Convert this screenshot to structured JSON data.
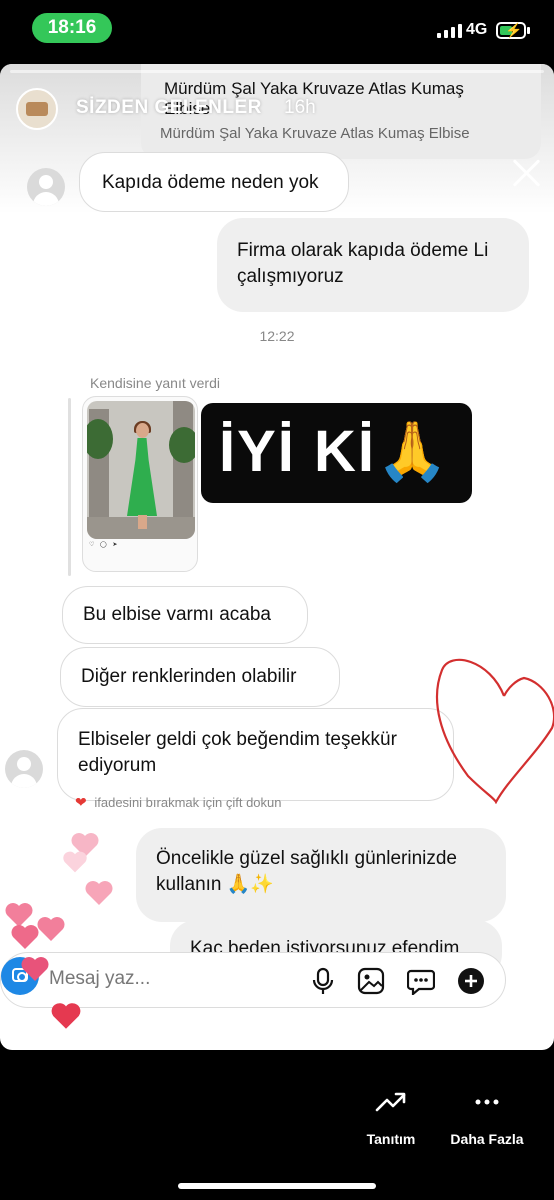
{
  "status_bar": {
    "time": "18:16",
    "network": "4G",
    "battery_level": 0.55
  },
  "story": {
    "title": "SİZDEN GELENLER",
    "time_ago": "16h",
    "product_preview": {
      "title": "Mürdüm Şal Yaka Kruvaze Atlas Kumaş Elbise",
      "subtitle": "Mürdüm Şal Yaka Kruvaze Atlas Kumaş Elbise"
    },
    "chat": {
      "messages": [
        {
          "text": "Kapıda ödeme neden yok"
        },
        {
          "text": "Firma olarak kapıda ödeme Li çalışmıyoruz"
        },
        {
          "text": "Bu elbise  varmı acaba"
        },
        {
          "text": "Diğer  renklerinden olabilir"
        },
        {
          "text": "Elbiseler geldi çok beğendim  teşekkür ediyorum"
        },
        {
          "text": "Öncelikle güzel sağlıklı günlerinizde kullanın 🙏✨"
        },
        {
          "text": "Kaç beden istiyorsunuz efendim"
        }
      ],
      "timestamp": "12:22",
      "reply_label": "Kendisine yanıt verdi",
      "reply_sticker": "İYİ Kİ🙏",
      "reaction_hint": "ifadesini bırakmak için çift dokun",
      "reaction_heart": "❤",
      "input_placeholder": "Mesaj yaz..."
    }
  },
  "bottom_bar": {
    "promote_label": "Tanıtım",
    "more_label": "Daha Fazla"
  }
}
